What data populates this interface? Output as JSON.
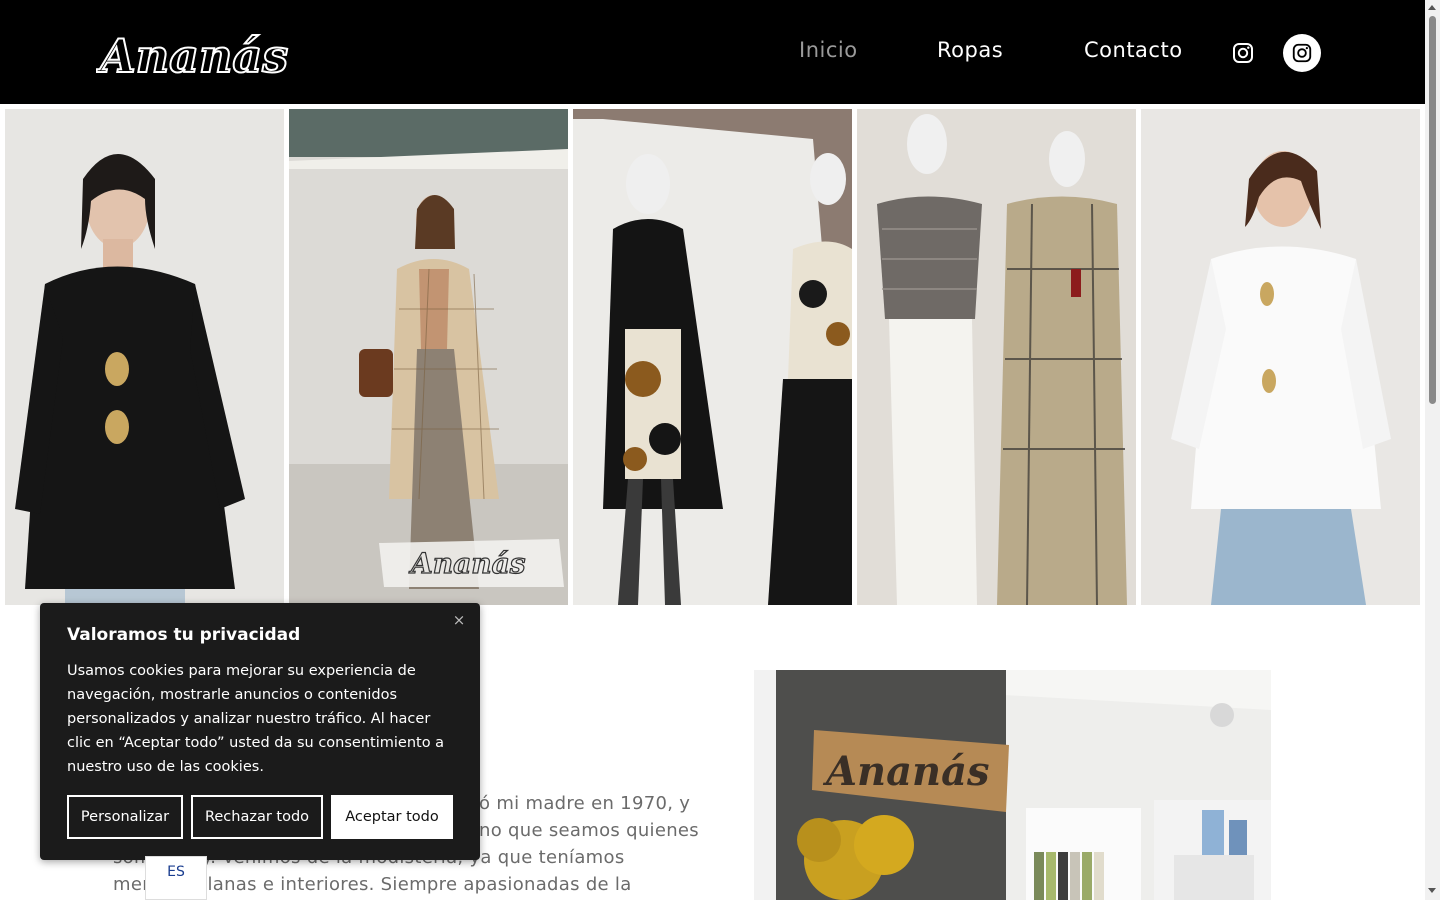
{
  "header": {
    "logo_text": "Ananás",
    "nav": [
      {
        "label": "Inicio",
        "active": true
      },
      {
        "label": "Ropas",
        "active": false
      },
      {
        "label": "Contacto",
        "active": false
      }
    ],
    "icons": [
      "instagram-icon",
      "instagram-icon"
    ]
  },
  "gallery": {
    "items": [
      {
        "name": "model-black-shirt"
      },
      {
        "name": "model-plaid-coat",
        "overlay_text": "Ananás"
      },
      {
        "name": "mannequins-black-dress"
      },
      {
        "name": "mannequins-knit-plaid"
      },
      {
        "name": "model-white-shirt"
      }
    ]
  },
  "about": {
    "lines": [
      "ó mi madre en 1970, y",
      "no que seamos quienes",
      "somos hoy. Venimos de la modistería, ya que teníamos",
      "mercería, lanas e interiores. Siempre apasionadas de la"
    ],
    "shop_sign": "Ananás"
  },
  "cookie": {
    "title": "Valoramos tu privacidad",
    "description": "Usamos cookies para mejorar su experiencia de navegación, mostrarle anuncios o contenidos personalizados y analizar nuestro tráfico. Al hacer clic en “Aceptar todo” usted da su consentimiento a nuestro uso de las cookies.",
    "close_symbol": "×",
    "buttons": {
      "customize": "Personalizar",
      "reject": "Rechazar todo",
      "accept": "Aceptar todo"
    }
  },
  "language": {
    "code": "ES"
  },
  "colors": {
    "header_bg": "#000000",
    "nav_active": "#9a9a9a",
    "cookie_bg": "#1b1b1b"
  }
}
